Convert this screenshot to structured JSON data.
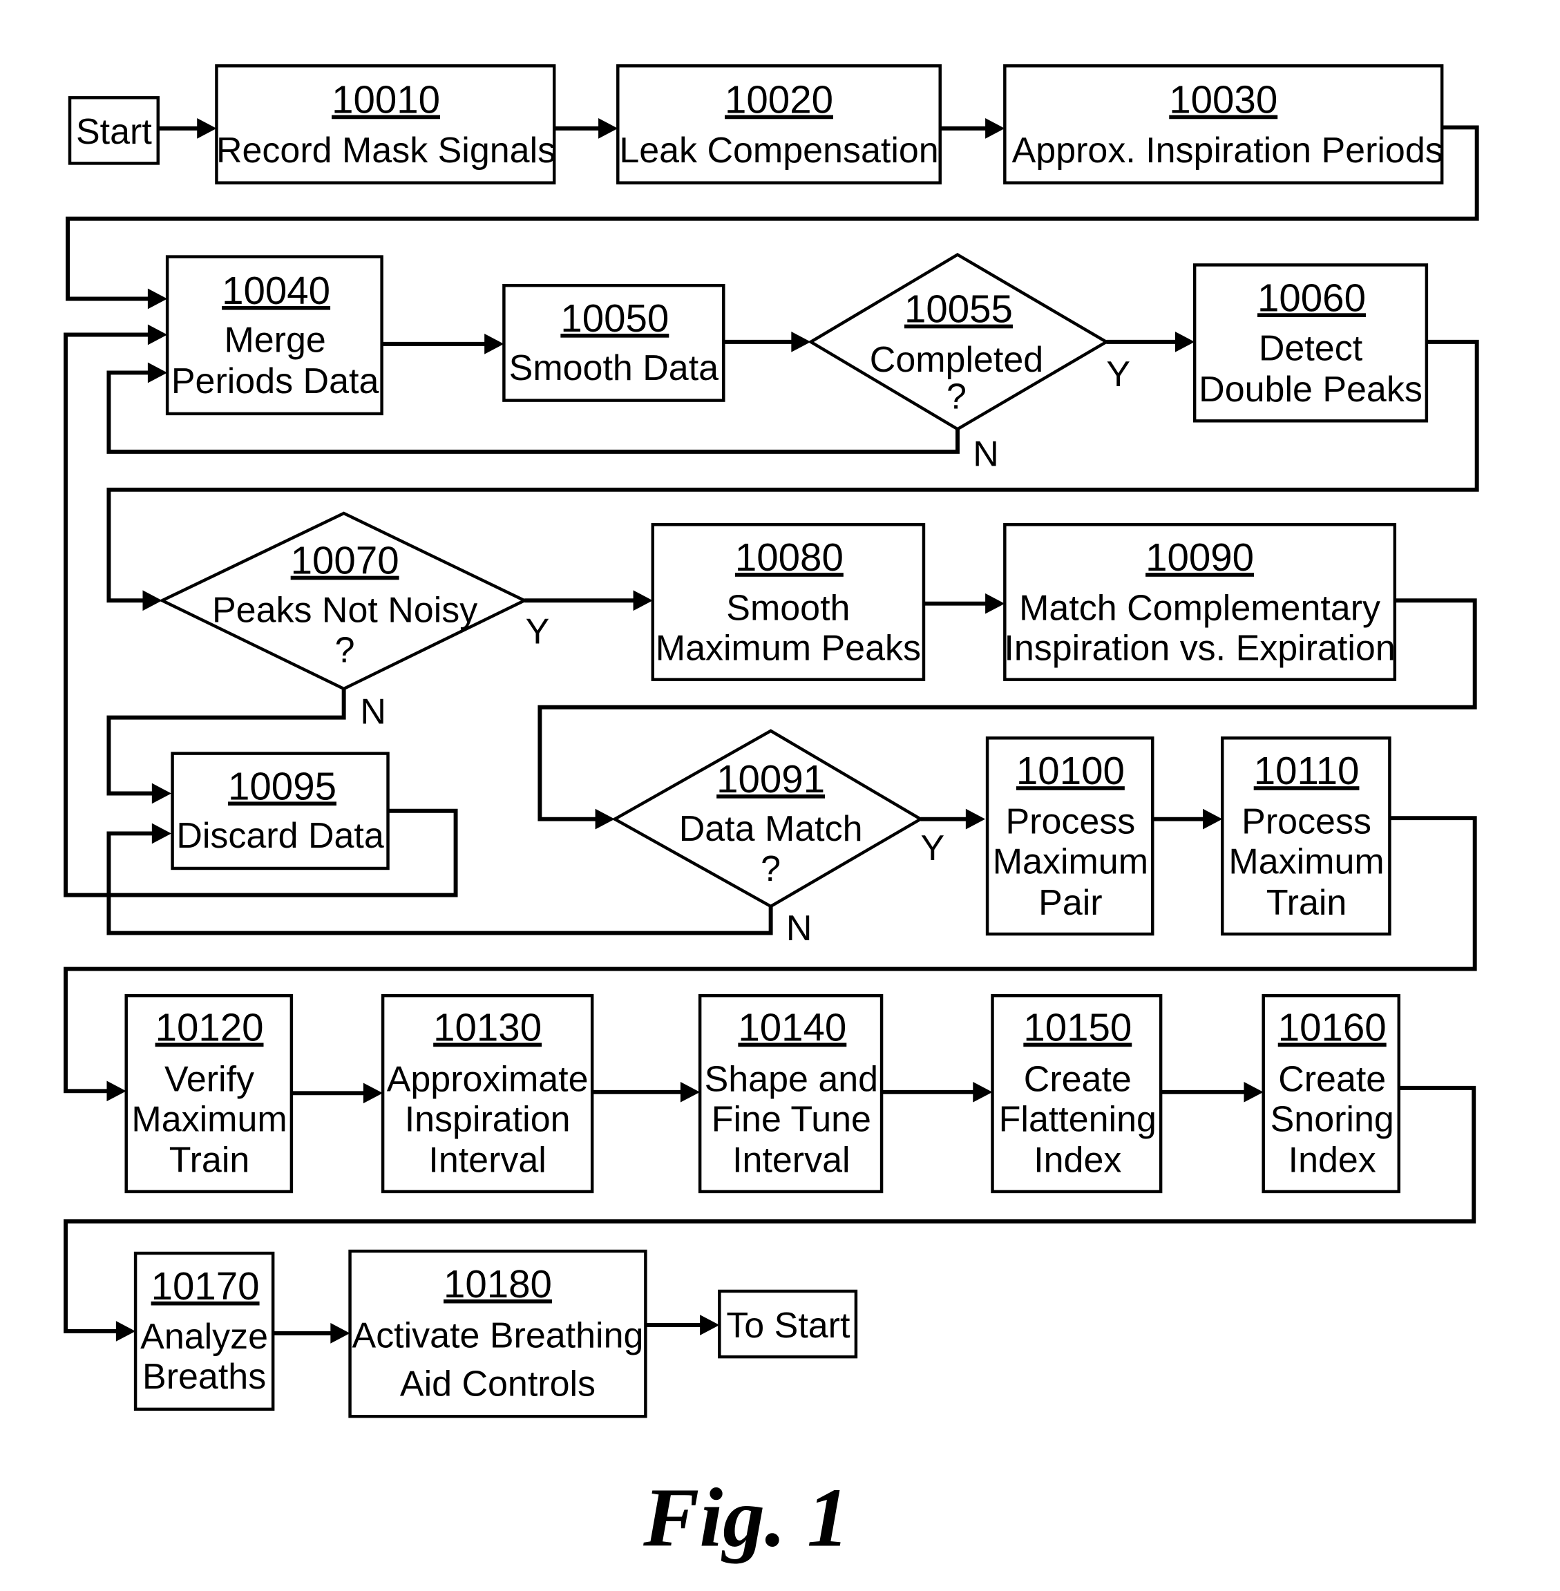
{
  "figure_caption": "Fig. 1",
  "terminals": {
    "start": "Start",
    "to_start": "To Start"
  },
  "steps": {
    "s10010": {
      "id": "10010",
      "lines": [
        "Record Mask Signals"
      ]
    },
    "s10020": {
      "id": "10020",
      "lines": [
        "Leak Compensation"
      ]
    },
    "s10030": {
      "id": "10030",
      "lines": [
        "Approx. Inspiration Periods"
      ]
    },
    "s10040": {
      "id": "10040",
      "lines": [
        "Merge",
        "Periods Data"
      ]
    },
    "s10050": {
      "id": "10050",
      "lines": [
        "Smooth Data"
      ]
    },
    "s10060": {
      "id": "10060",
      "lines": [
        "Detect",
        "Double Peaks"
      ]
    },
    "s10080": {
      "id": "10080",
      "lines": [
        "Smooth",
        "Maximum Peaks"
      ]
    },
    "s10090": {
      "id": "10090",
      "lines": [
        "Match Complementary",
        "Inspiration vs. Expiration"
      ]
    },
    "s10095": {
      "id": "10095",
      "lines": [
        "Discard Data"
      ]
    },
    "s10100": {
      "id": "10100",
      "lines": [
        "Process",
        "Maximum",
        "Pair"
      ]
    },
    "s10110": {
      "id": "10110",
      "lines": [
        "Process",
        "Maximum",
        "Train"
      ]
    },
    "s10120": {
      "id": "10120",
      "lines": [
        "Verify",
        "Maximum",
        "Train"
      ]
    },
    "s10130": {
      "id": "10130",
      "lines": [
        "Approximate",
        "Inspiration",
        "Interval"
      ]
    },
    "s10140": {
      "id": "10140",
      "lines": [
        "Shape and",
        "Fine Tune",
        "Interval"
      ]
    },
    "s10150": {
      "id": "10150",
      "lines": [
        "Create",
        "Flattening",
        "Index"
      ]
    },
    "s10160": {
      "id": "10160",
      "lines": [
        "Create",
        "Snoring",
        "Index"
      ]
    },
    "s10170": {
      "id": "10170",
      "lines": [
        "Analyze",
        "Breaths"
      ]
    },
    "s10180": {
      "id": "10180",
      "lines": [
        "Activate Breathing",
        "Aid Controls"
      ]
    }
  },
  "decisions": {
    "d10055": {
      "id": "10055",
      "lines": [
        "Completed",
        "?"
      ],
      "yes": "Y",
      "no": "N"
    },
    "d10070": {
      "id": "10070",
      "lines": [
        "Peaks Not Noisy",
        "?"
      ],
      "yes": "Y",
      "no": "N"
    },
    "d10091": {
      "id": "10091",
      "lines": [
        "Data Match",
        "?"
      ],
      "yes": "Y",
      "no": "N"
    }
  }
}
